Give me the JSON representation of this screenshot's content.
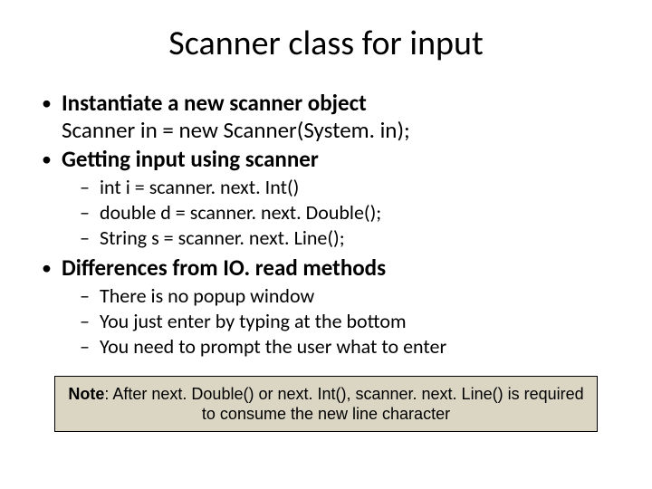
{
  "title": "Scanner class for input",
  "bullets": {
    "b1": {
      "line1": "Instantiate a new scanner object",
      "line2": "Scanner in = new Scanner(System. in);"
    },
    "b2": {
      "line1": "Getting input using scanner",
      "sub": {
        "s1": "int i = scanner. next. Int()",
        "s2": "double d = scanner. next. Double();",
        "s3": "String s = scanner. next. Line();"
      }
    },
    "b3": {
      "line1": "Differences from IO. read methods",
      "sub": {
        "s1": "There is no popup window",
        "s2": "You just enter by typing at the bottom",
        "s3": "You need to prompt the user what to enter"
      }
    }
  },
  "note": {
    "label": "Note",
    "text": ": After next. Double() or next. Int(), scanner. next. Line() is required to consume the new line character"
  }
}
